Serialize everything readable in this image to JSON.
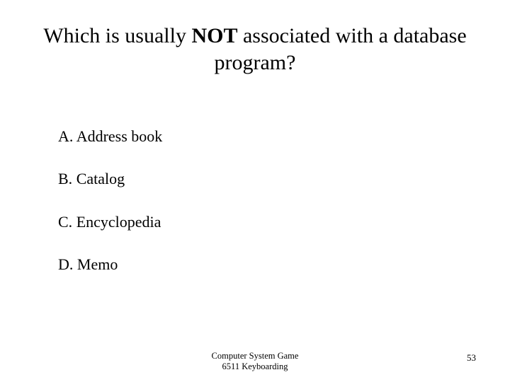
{
  "question": {
    "pre": "Which is usually ",
    "emph": "NOT",
    "post": " associated with a database program?"
  },
  "options": [
    {
      "letter": "A.",
      "text": "Address book"
    },
    {
      "letter": "B.",
      "text": "Catalog"
    },
    {
      "letter": "C.",
      "text": "Encyclopedia"
    },
    {
      "letter": "D.",
      "text": "Memo"
    }
  ],
  "footer": {
    "center_line1": "Computer System Game",
    "center_line2": "6511 Keyboarding",
    "page_number": "53"
  }
}
